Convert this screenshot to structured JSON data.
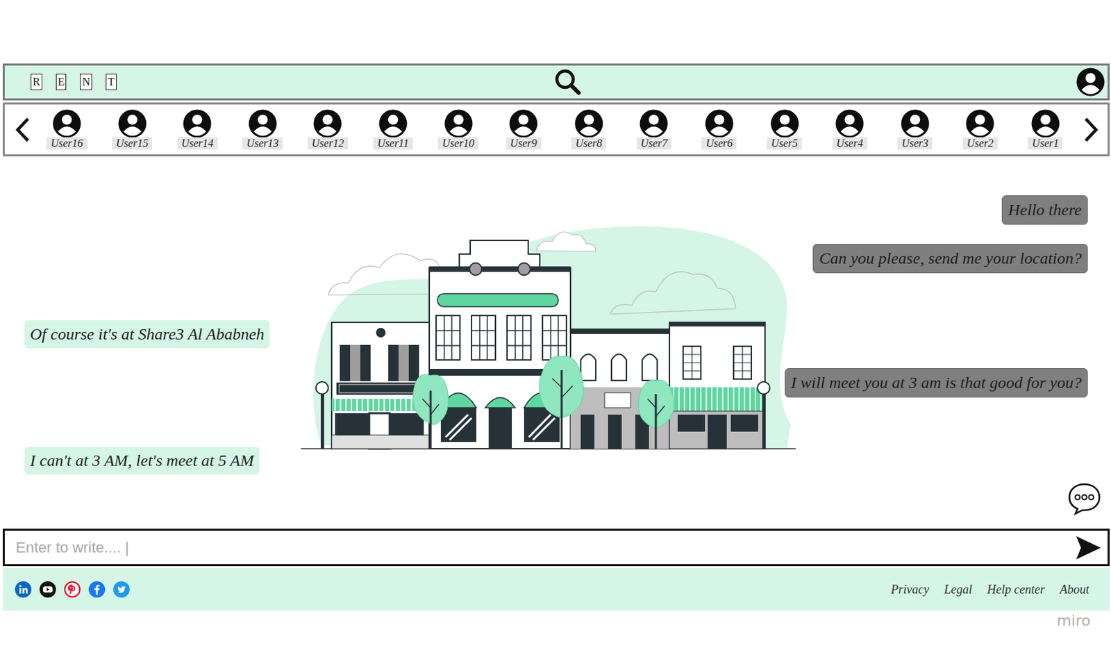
{
  "header": {
    "logo": [
      "R",
      "E",
      "N",
      "T"
    ]
  },
  "users": [
    {
      "name": "User16"
    },
    {
      "name": "User15"
    },
    {
      "name": "User14"
    },
    {
      "name": "User13"
    },
    {
      "name": "User12"
    },
    {
      "name": "User11"
    },
    {
      "name": "User10"
    },
    {
      "name": "User9"
    },
    {
      "name": "User8"
    },
    {
      "name": "User7"
    },
    {
      "name": "User6"
    },
    {
      "name": "User5"
    },
    {
      "name": "User4"
    },
    {
      "name": "User3"
    },
    {
      "name": "User2"
    },
    {
      "name": "User1"
    }
  ],
  "messages": [
    {
      "text": "Hello there",
      "kind": "sent"
    },
    {
      "text": "Can you please, send me your location?",
      "kind": "sent"
    },
    {
      "text": "Of course it's at Share3 Al Ababneh",
      "kind": "received"
    },
    {
      "text": "I will meet you at 3 am is that good for you?",
      "kind": "sent"
    },
    {
      "text": "I can't at 3 AM, let's meet at 5 AM",
      "kind": "received"
    }
  ],
  "input": {
    "placeholder": "Enter to write.... |"
  },
  "footer": {
    "links": [
      "Privacy",
      "Legal",
      "Help center",
      "About"
    ]
  },
  "watermark": "miro"
}
